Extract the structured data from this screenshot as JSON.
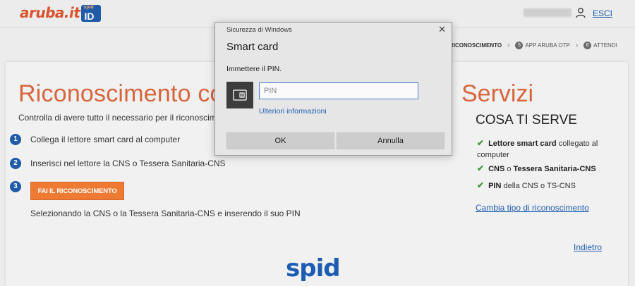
{
  "header": {
    "logo_text": "aruba.it",
    "logo_badge_small": "spid",
    "logo_badge_id": "ID",
    "logout_label": "ESCI"
  },
  "steps": {
    "current_label": "RICONOSCIMENTO",
    "items": [
      {
        "num": "5",
        "label": "APP ARUBA OTP"
      },
      {
        "num": "6",
        "label": "ATTENDI"
      }
    ]
  },
  "main": {
    "title": "Riconoscimento co",
    "title_right": "Servizi",
    "subtitle": "Controlla di avere tutto il necessario per il riconoscimento e s",
    "steps": [
      {
        "num": "1",
        "text": "Collega il lettore smart card al computer"
      },
      {
        "num": "2",
        "text": "Inserisci nel lettore la CNS o Tessera Sanitaria-CNS"
      },
      {
        "num": "3",
        "text": ""
      }
    ],
    "action_button": "FAI IL RICONOSCIMENTO",
    "action_note": "Selezionando la CNS o la Tessera Sanitaria-CNS e inserendo il suo PIN"
  },
  "requirements": {
    "title": "COSA TI SERVE",
    "items": [
      {
        "bold": "Lettore smart card",
        "rest": " collegato al computer"
      },
      {
        "bold": "CNS",
        "mid": " o ",
        "bold2": "Tessera Sanitaria-CNS",
        "rest": ""
      },
      {
        "bold": "PIN",
        "rest": " della CNS o TS-CNS"
      }
    ],
    "change_link": "Cambia tipo di riconoscimento"
  },
  "footer": {
    "back_link": "Indietro",
    "spid_logo": "spid"
  },
  "dialog": {
    "caption": "Sicurezza di Windows",
    "close_glyph": "✕",
    "title": "Smart card",
    "prompt": "Immettere il PIN.",
    "pin_placeholder": "PIN",
    "pin_value": "",
    "more_info": "Ulteriori informazioni",
    "ok_label": "OK",
    "cancel_label": "Annulla"
  },
  "colors": {
    "accent_orange": "#d8653c",
    "button_orange": "#ee7a33",
    "brand_blue": "#1f5ba8",
    "link_blue": "#1e5db2",
    "check_green": "#3d9b35"
  }
}
